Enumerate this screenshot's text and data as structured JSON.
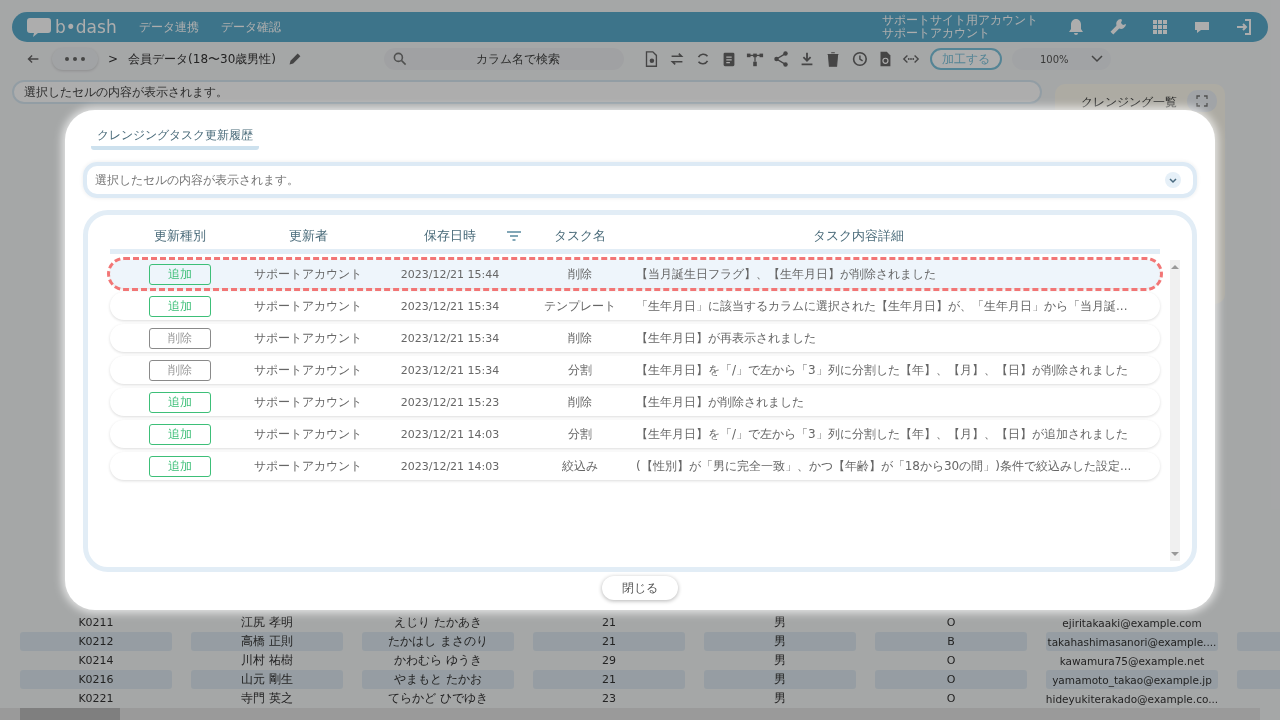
{
  "header": {
    "logo": "b•dash",
    "nav": [
      "データ連携",
      "データ確認"
    ],
    "account": [
      "サポートサイト用アカウント",
      "サポートアカウント"
    ]
  },
  "toolbar": {
    "separator": ">",
    "breadcrumb": "会員データ(18〜30歳男性)",
    "search": {
      "placeholder": "カラム名で検索"
    },
    "process_button": "加工する",
    "zoom": "100%"
  },
  "info_bar": {
    "placeholder": "選択したセルの内容が表示されます。"
  },
  "cleansing_panel": {
    "title": "クレンジング一覧"
  },
  "data_rows": [
    [
      "K0211",
      "江尻 孝明",
      "えじり たかあき",
      "21",
      "男",
      "O",
      "ejiritakaaki@example.com"
    ],
    [
      "K0212",
      "高橋 正則",
      "たかはし まさのり",
      "21",
      "男",
      "B",
      "takahashimasanori@example...."
    ],
    [
      "K0214",
      "川村 祐樹",
      "かわむら ゆうき",
      "29",
      "男",
      "O",
      "kawamura75@example.net"
    ],
    [
      "K0216",
      "山元 剛生",
      "やまもと たかお",
      "21",
      "男",
      "O",
      "yamamoto_takao@example.jp"
    ],
    [
      "K0221",
      "寺門 英之",
      "てらかど ひでゆき",
      "23",
      "男",
      "O",
      "hideyukiterakado@example.co..."
    ]
  ],
  "modal": {
    "title": "クレンジングタスク更新履歴",
    "cell_field": {
      "placeholder": "選択したセルの内容が表示されます。"
    },
    "columns": [
      "更新種別",
      "更新者",
      "保存日時",
      "タスク名",
      "タスク内容詳細"
    ],
    "rows": [
      {
        "type": "追加",
        "kind": "add",
        "updater": "サポートアカウント",
        "saved_at": "2023/12/21 15:44",
        "task": "削除",
        "detail": "【当月誕生日フラグ】、【生年月日】が削除されました",
        "selected": true
      },
      {
        "type": "追加",
        "kind": "add",
        "updater": "サポートアカウント",
        "saved_at": "2023/12/21 15:34",
        "task": "テンプレート",
        "detail": "「生年月日」に該当するカラムに選択された【生年月日】が、「生年月日」から「当月誕...",
        "selected": false
      },
      {
        "type": "削除",
        "kind": "delete",
        "updater": "サポートアカウント",
        "saved_at": "2023/12/21 15:34",
        "task": "削除",
        "detail": "【生年月日】が再表示されました",
        "selected": false
      },
      {
        "type": "削除",
        "kind": "delete",
        "updater": "サポートアカウント",
        "saved_at": "2023/12/21 15:34",
        "task": "分割",
        "detail": "【生年月日】を「/」で左から「3」列に分割した【年】、【月】、【日】が削除されました",
        "selected": false
      },
      {
        "type": "追加",
        "kind": "add",
        "updater": "サポートアカウント",
        "saved_at": "2023/12/21 15:23",
        "task": "削除",
        "detail": "【生年月日】が削除されました",
        "selected": false
      },
      {
        "type": "追加",
        "kind": "add",
        "updater": "サポートアカウント",
        "saved_at": "2023/12/21 14:03",
        "task": "分割",
        "detail": "【生年月日】を「/」で左から「3」列に分割した【年】、【月】、【日】が追加されました",
        "selected": false
      },
      {
        "type": "追加",
        "kind": "add",
        "updater": "サポートアカウント",
        "saved_at": "2023/12/21 14:03",
        "task": "絞込み",
        "detail": "(【性別】が「男に完全一致」、かつ【年齢】が「18から30の間」)条件で絞込みした設定...",
        "selected": false
      }
    ],
    "close_button": "閉じる"
  }
}
